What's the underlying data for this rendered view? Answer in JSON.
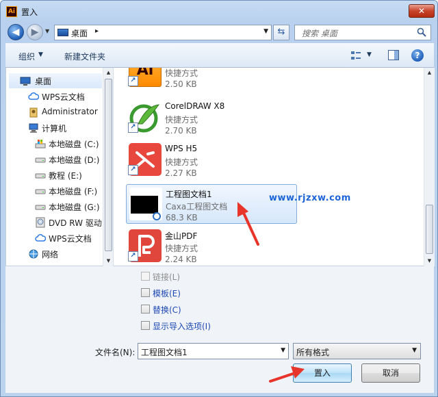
{
  "window": {
    "title": "置入",
    "app_icon_text": "Ai",
    "close_glyph": "✕"
  },
  "address": {
    "location": "桌面",
    "separator": "▸",
    "dropdown_glyph": "▼"
  },
  "search": {
    "placeholder": "搜索 桌面"
  },
  "toolbar": {
    "organize_label": "组织",
    "new_folder_label": "新建文件夹",
    "help_glyph": "?"
  },
  "navpane": {
    "items": [
      {
        "label": "桌面",
        "icon": "desktop-icon"
      },
      {
        "label": "WPS云文档",
        "icon": "cloud-icon"
      },
      {
        "label": "Administrator",
        "icon": "user-folder-icon"
      },
      {
        "label": "计算机",
        "icon": "computer-icon"
      },
      {
        "label": "本地磁盘 (C:)",
        "icon": "system-drive-icon"
      },
      {
        "label": "本地磁盘 (D:)",
        "icon": "drive-icon"
      },
      {
        "label": "教程 (E:)",
        "icon": "drive-icon"
      },
      {
        "label": "本地磁盘 (F:)",
        "icon": "drive-icon"
      },
      {
        "label": "本地磁盘 (G:)",
        "icon": "drive-icon"
      },
      {
        "label": "DVD RW 驱动",
        "icon": "dvd-drive-icon"
      },
      {
        "label": "WPS云文档",
        "icon": "cloud-icon"
      },
      {
        "label": "网络",
        "icon": "network-icon"
      }
    ]
  },
  "files": [
    {
      "name": "",
      "type": "快捷方式",
      "size": "2.50 KB",
      "icon": "illustrator-icon",
      "icon_text": "Ai"
    },
    {
      "name": "CorelDRAW X8",
      "type": "快捷方式",
      "size": "2.70 KB",
      "icon": "coreldraw-icon"
    },
    {
      "name": "WPS H5",
      "type": "快捷方式",
      "size": "2.27 KB",
      "icon": "wps-h5-icon"
    },
    {
      "name": "工程图文档1",
      "type": "Caxa工程图文档",
      "size": "68.3 KB",
      "icon": "caxa-document-icon"
    },
    {
      "name": "金山PDF",
      "type": "快捷方式",
      "size": "2.24 KB",
      "icon": "kingsoft-pdf-icon"
    }
  ],
  "watermark": "www.rjzxw.com",
  "options": {
    "link": "链接(L)",
    "template": "模板(E)",
    "replace": "替换(C)",
    "show_import": "显示导入选项(I)"
  },
  "bottom": {
    "filename_label": "文件名(N):",
    "filename_value": "工程图文档1",
    "filter_value": "所有格式",
    "place_button": "置入",
    "cancel_button": "取消"
  },
  "colors": {
    "annotation_arrow": "#e8352b",
    "link_text": "#1d48b5",
    "watermark": "#1c64d8"
  }
}
